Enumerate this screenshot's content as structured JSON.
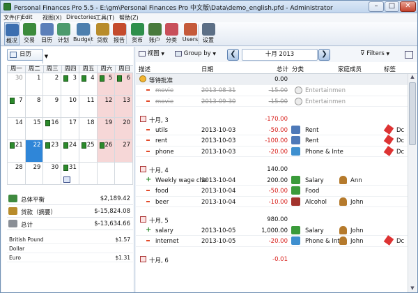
{
  "window": {
    "title": "Personal Finances Pro 5.5 - E:\\gm\\Personal Finances Pro 中文版\\Data\\demo_english.pfd - Administrator",
    "min": "–",
    "max": "□",
    "close": "✕"
  },
  "menu": [
    "文件(F)",
    "Edit",
    "视图(X)",
    "Directories",
    "工具(T)",
    "帮助(Z)"
  ],
  "toolbar": [
    {
      "label": "概况",
      "icon": "overview-icon",
      "color": "#3c6fb0"
    },
    {
      "label": "交易",
      "icon": "transactions-icon",
      "color": "#3b8a3b"
    },
    {
      "label": "日历",
      "icon": "calendar-icon",
      "color": "#5b7fb9"
    },
    {
      "label": "计划",
      "icon": "plan-icon",
      "color": "#4c9a6c"
    },
    {
      "label": "Budget",
      "icon": "budget-icon",
      "color": "#4d7fae"
    },
    {
      "label": "贷款",
      "icon": "loans-icon",
      "color": "#b88c2b"
    },
    {
      "label": "报告",
      "icon": "reports-icon",
      "color": "#c44b2d"
    },
    {
      "label": "货币",
      "icon": "currency-icon",
      "color": "#2e8f4b"
    },
    {
      "label": "账户",
      "icon": "accounts-icon",
      "color": "#487a3c"
    },
    {
      "label": "分类",
      "icon": "categories-icon",
      "color": "#c84f5a"
    },
    {
      "label": "Users",
      "icon": "users-icon",
      "color": "#c55a3a"
    },
    {
      "label": "设置",
      "icon": "settings-icon",
      "color": "#5c6f86"
    }
  ],
  "left": {
    "view_button": "日历",
    "weekdays": [
      "周一",
      "周二",
      "周三",
      "周四",
      "周五",
      "周六",
      "周日"
    ],
    "weeks": [
      [
        {
          "d": "30",
          "o": true,
          "m": false
        },
        {
          "d": "1",
          "m": false
        },
        {
          "d": "2",
          "m": false
        },
        {
          "d": "3",
          "m": true
        },
        {
          "d": "4",
          "m": true
        },
        {
          "d": "5",
          "m": true,
          "w": true
        },
        {
          "d": "6",
          "m": true,
          "w": true
        }
      ],
      [
        {
          "d": "7",
          "m": true
        },
        {
          "d": "8",
          "m": false
        },
        {
          "d": "9",
          "m": false
        },
        {
          "d": "10",
          "m": false
        },
        {
          "d": "11",
          "m": false
        },
        {
          "d": "12",
          "m": false,
          "w": true
        },
        {
          "d": "13",
          "m": false,
          "w": true
        }
      ],
      [
        {
          "d": "14",
          "m": false
        },
        {
          "d": "15",
          "m": false
        },
        {
          "d": "16",
          "m": true
        },
        {
          "d": "17",
          "m": false
        },
        {
          "d": "18",
          "m": false
        },
        {
          "d": "19",
          "m": false,
          "w": true
        },
        {
          "d": "20",
          "m": false,
          "w": true
        }
      ],
      [
        {
          "d": "21",
          "m": true
        },
        {
          "d": "22",
          "m": false,
          "sel": true
        },
        {
          "d": "23",
          "m": true
        },
        {
          "d": "24",
          "m": true
        },
        {
          "d": "25",
          "m": true
        },
        {
          "d": "26",
          "m": true,
          "w": true
        },
        {
          "d": "27",
          "m": false,
          "w": true
        }
      ],
      [
        {
          "d": "28",
          "m": false
        },
        {
          "d": "29",
          "m": false
        },
        {
          "d": "30",
          "m": false
        },
        {
          "d": "31",
          "m": true,
          "t": true
        },
        {
          "d": "",
          "m": false
        },
        {
          "d": "",
          "m": false
        },
        {
          "d": "",
          "m": false
        }
      ]
    ],
    "summary": [
      {
        "label": "总体平衡",
        "value": "$2,189.42",
        "icon": "balance-icon"
      },
      {
        "label": "贷款（摘要）",
        "value": "$-15,824.08",
        "icon": "loan-summary-icon"
      },
      {
        "label": "总计",
        "value": "$-13,634.66",
        "icon": "total-scale-icon"
      }
    ],
    "currencies": [
      {
        "name": "British Pound",
        "value": "$1.57"
      },
      {
        "name": "Dollar",
        "value": ""
      },
      {
        "name": "Euro",
        "value": "$1.31"
      }
    ]
  },
  "right": {
    "view_label": "视图",
    "groupby_label": "Group by",
    "month": "十月 2013",
    "filters_label": "Filters",
    "columns": {
      "desc": "描述",
      "date": "日期",
      "total": "总计",
      "category": "分类",
      "member": "家庭成员",
      "tag": "标签"
    },
    "rows": [
      {
        "type": "pending",
        "desc": "等待批准",
        "total": "0.00"
      },
      {
        "type": "void",
        "desc": "movie",
        "date": "2013-08-31",
        "total": "-15.00",
        "cat": "Entertainmen"
      },
      {
        "type": "void",
        "desc": "movie",
        "date": "2013-09-30",
        "total": "-15.00",
        "cat": "Entertainmen"
      },
      {
        "type": "spacer"
      },
      {
        "type": "group",
        "desc": "十月, 3",
        "total": "-170.00"
      },
      {
        "type": "tx",
        "sign": "-",
        "desc": "utils",
        "date": "2013-10-03",
        "total": "-50.00",
        "cat": "Rent",
        "catColor": "#4e79b8",
        "tag": "Dc"
      },
      {
        "type": "tx",
        "sign": "-",
        "desc": "rent",
        "date": "2013-10-03",
        "total": "-100.00",
        "cat": "Rent",
        "catColor": "#4e79b8",
        "tag": "Dc"
      },
      {
        "type": "tx",
        "sign": "-",
        "desc": "phone",
        "date": "2013-10-03",
        "total": "-20.00",
        "cat": "Phone & Inte",
        "catColor": "#3e8fcf",
        "tag": "Dc"
      },
      {
        "type": "spacer"
      },
      {
        "type": "group",
        "desc": "十月, 4",
        "total": "140.00"
      },
      {
        "type": "tx",
        "sign": "+",
        "desc": "Weekly wage che",
        "date": "2013-10-04",
        "total": "200.00",
        "cat": "Salary",
        "catColor": "#3a9b3a",
        "member": "Ann"
      },
      {
        "type": "tx",
        "sign": "-",
        "desc": "food",
        "date": "2013-10-04",
        "total": "-50.00",
        "cat": "Food",
        "catColor": "#3a9b3a"
      },
      {
        "type": "tx",
        "sign": "-",
        "desc": "beer",
        "date": "2013-10-04",
        "total": "-10.00",
        "cat": "Alcohol",
        "catColor": "#a2332c",
        "member": "John"
      },
      {
        "type": "spacer"
      },
      {
        "type": "group",
        "desc": "十月, 5",
        "total": "980.00"
      },
      {
        "type": "tx",
        "sign": "+",
        "desc": "salary",
        "date": "2013-10-05",
        "total": "1,000.00",
        "cat": "Salary",
        "catColor": "#3a9b3a",
        "member": "John"
      },
      {
        "type": "tx",
        "sign": "-",
        "desc": "internet",
        "date": "2013-10-05",
        "total": "-20.00",
        "cat": "Phone & Inte",
        "catColor": "#3e8fcf",
        "member": "John",
        "tag": "Dc"
      },
      {
        "type": "spacer"
      },
      {
        "type": "group",
        "desc": "十月, 6",
        "total": "-0.01"
      }
    ]
  }
}
